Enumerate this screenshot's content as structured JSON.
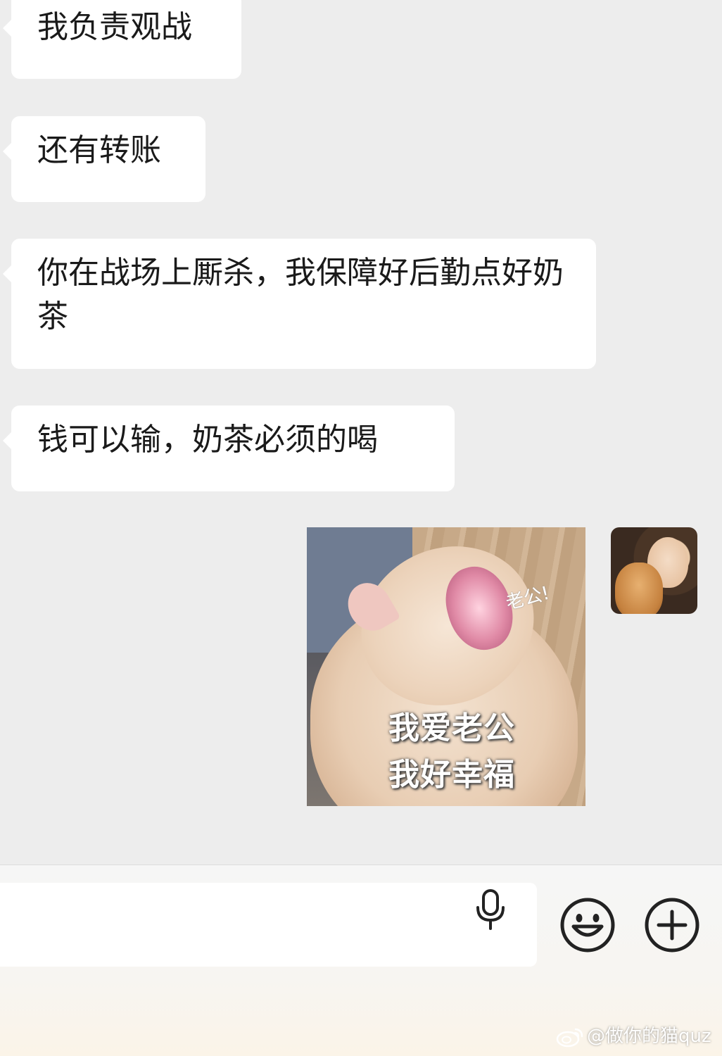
{
  "messages": [
    {
      "text": "我负责观战"
    },
    {
      "text": "还有转账"
    },
    {
      "text": "你在战场上厮杀，我保障好后勤点好奶茶"
    },
    {
      "text": "钱可以输，奶茶必须的喝"
    }
  ],
  "sticker": {
    "caption_line1": "我爱老公",
    "caption_line2": "我好幸福",
    "small_text": "老公!"
  },
  "input": {
    "placeholder": ""
  },
  "watermark": {
    "text": "@做你的猫quz",
    "icon": "weibo-icon"
  },
  "icons": {
    "mic": "microphone-icon",
    "emoji": "smiley-icon",
    "plus": "plus-icon"
  },
  "colors": {
    "background": "#ededed",
    "bubble": "#ffffff",
    "text": "#1a1a1a",
    "icon": "#222222"
  }
}
